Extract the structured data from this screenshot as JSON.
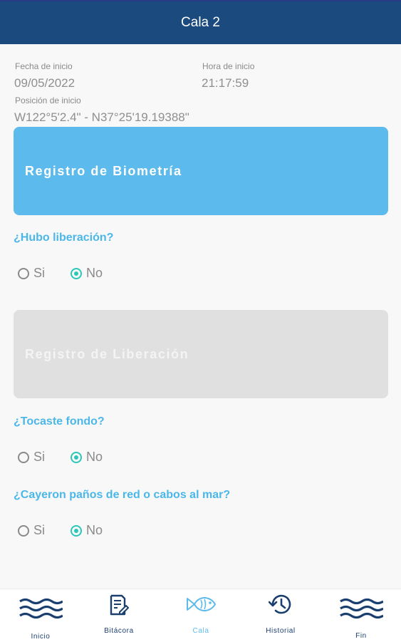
{
  "header": {
    "title": "Cala 2"
  },
  "info": {
    "start_date_label": "Fecha de inicio",
    "start_date_value": "09/05/2022",
    "start_time_label": "Hora de inicio",
    "start_time_value": "21:17:59",
    "start_position_label": "Posición de inicio",
    "start_position_value": "W122°5'2.4\" - N37°25'19.19388\""
  },
  "actions": {
    "biometry_label": "Registro de Biometría",
    "release_label": "Registro de Liberación"
  },
  "questions": [
    {
      "text": "¿Hubo liberación?",
      "options": [
        "Si",
        "No"
      ],
      "selected": "No"
    },
    {
      "text": "¿Tocaste fondo?",
      "options": [
        "Si",
        "No"
      ],
      "selected": "No"
    },
    {
      "text": "¿Cayeron paños de red o cabos al mar?",
      "options": [
        "Si",
        "No"
      ],
      "selected": "No"
    }
  ],
  "nav": {
    "items": [
      {
        "label": "Inicio",
        "icon": "waves-icon"
      },
      {
        "label": "Bitácora",
        "icon": "logbook-icon"
      },
      {
        "label": "Cala",
        "icon": "fish-icon",
        "active": true
      },
      {
        "label": "Historial",
        "icon": "history-icon"
      },
      {
        "label": "Fin",
        "icon": "waves-icon"
      }
    ]
  },
  "colors": {
    "header_bg": "#1a4a7e",
    "accent": "#5cbbec",
    "radio_selected": "#2cc7b8",
    "disabled_button": "#e0e0e0",
    "nav_icon": "#1a3f6e"
  }
}
